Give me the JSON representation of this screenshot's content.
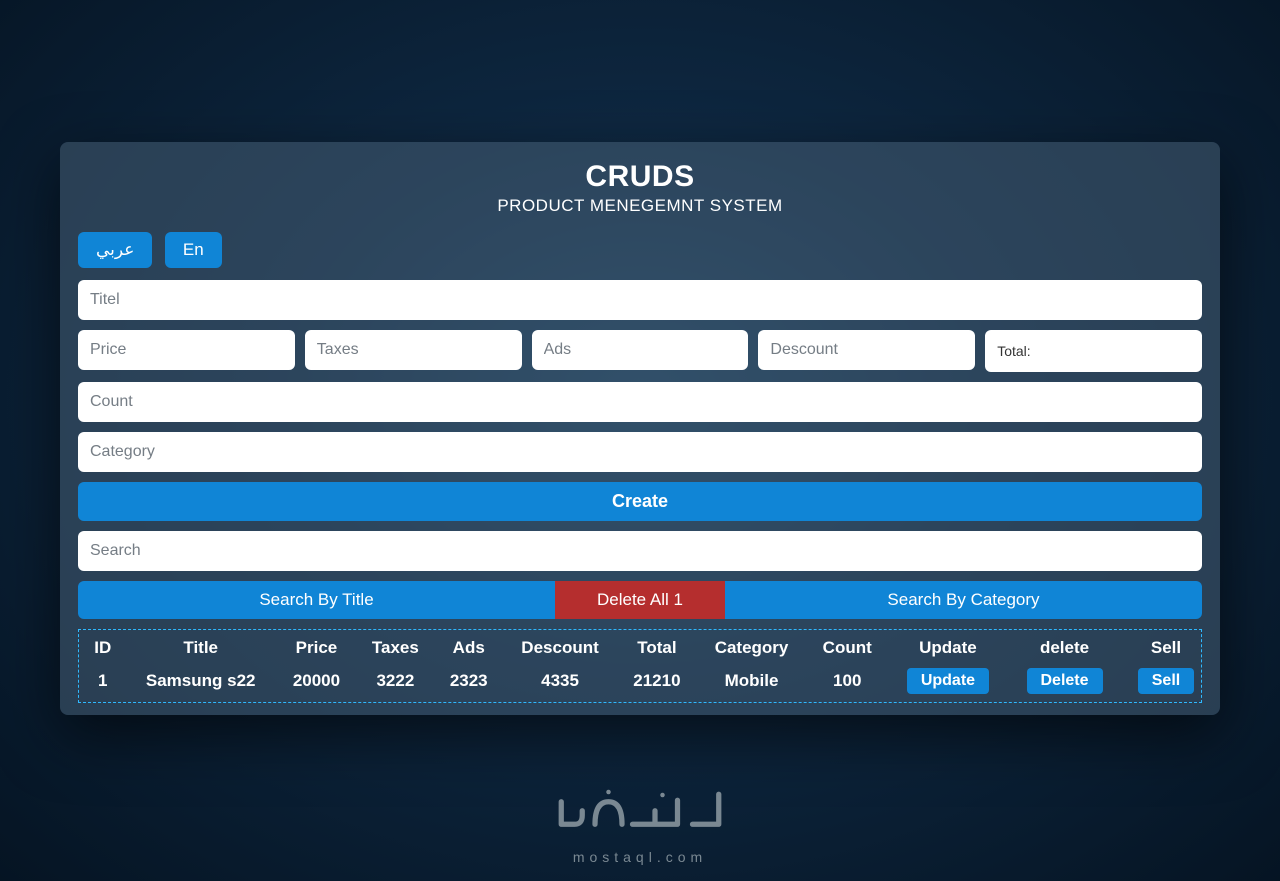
{
  "header": {
    "title": "CRUDS",
    "subtitle": "PRODUCT MENEGEMNT SYSTEM"
  },
  "lang": {
    "ar": "عربي",
    "en": "En"
  },
  "form": {
    "title_ph": "Titel",
    "price_ph": "Price",
    "taxes_ph": "Taxes",
    "ads_ph": "Ads",
    "discount_ph": "Descount",
    "total_label": "Total:",
    "count_ph": "Count",
    "category_ph": "Category",
    "create_btn": "Create",
    "search_ph": "Search"
  },
  "search_buttons": {
    "by_title": "Search By Title",
    "delete_all": "Delete All 1",
    "by_category": "Search By Category"
  },
  "table": {
    "headers": {
      "id": "ID",
      "title": "Title",
      "price": "Price",
      "taxes": "Taxes",
      "ads": "Ads",
      "discount": "Descount",
      "total": "Total",
      "category": "Category",
      "count": "Count",
      "update": "Update",
      "delete": "delete",
      "sell": "Sell"
    },
    "rows": [
      {
        "id": "1",
        "title": "Samsung s22",
        "price": "20000",
        "taxes": "3222",
        "ads": "2323",
        "discount": "4335",
        "total": "21210",
        "category": "Mobile",
        "count": "100"
      }
    ],
    "btn_labels": {
      "update": "Update",
      "delete": "Delete",
      "sell": "Sell"
    }
  },
  "footer": {
    "brand_sub": "mostaql.com"
  }
}
